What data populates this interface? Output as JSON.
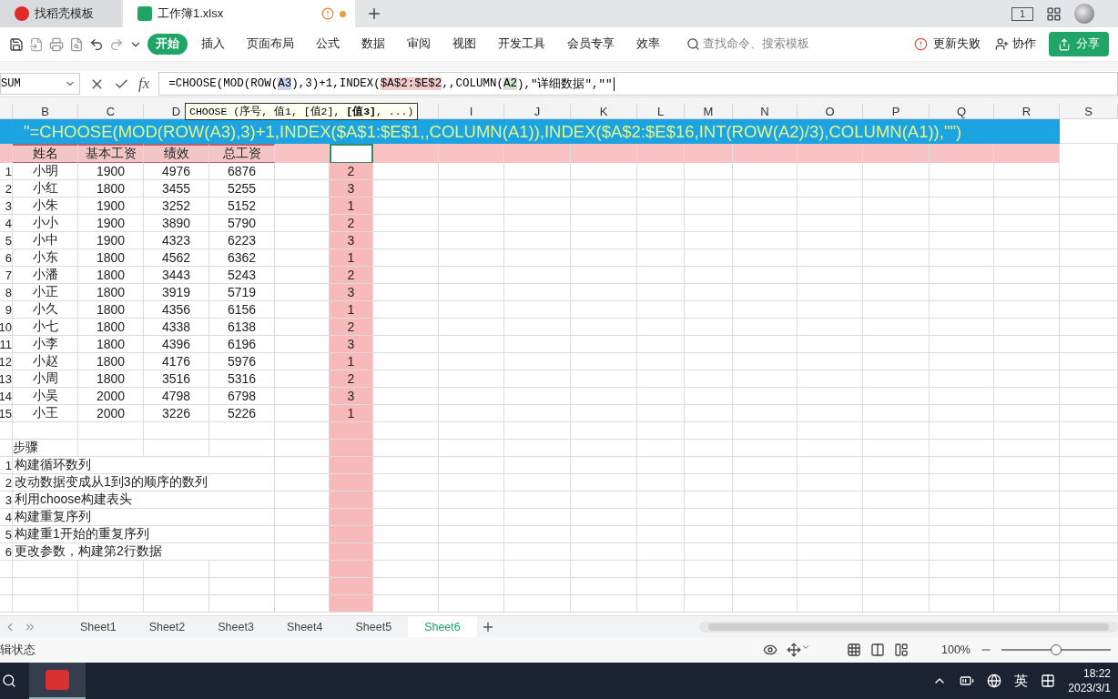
{
  "doc_tabs": [
    {
      "label": "找稻壳模板",
      "selected": false
    },
    {
      "label": "工作簿1.xlsx",
      "selected": true
    }
  ],
  "window_count": "1",
  "menu": [
    {
      "label": "开始",
      "selected": true
    },
    {
      "label": "插入",
      "selected": false
    },
    {
      "label": "页面布局",
      "selected": false
    },
    {
      "label": "公式",
      "selected": false
    },
    {
      "label": "数据",
      "selected": false
    },
    {
      "label": "审阅",
      "selected": false
    },
    {
      "label": "视图",
      "selected": false
    },
    {
      "label": "开发工具",
      "selected": false
    },
    {
      "label": "会员专享",
      "selected": false
    },
    {
      "label": "效率",
      "selected": false
    }
  ],
  "search": {
    "placeholder": "查找命令、搜索模板"
  },
  "update_status": "更新失败",
  "collaborate": "协作",
  "share": "分享",
  "name_box": "SUM",
  "fx_label": "fx",
  "formula": [
    {
      "text": "=CHOOSE(MOD(ROW("
    },
    {
      "text": "A3",
      "color": "#c9d4ee"
    },
    {
      "text": "),3)+1,INDEX("
    },
    {
      "text": "$A$2:$E$2",
      "color": "#f2caca"
    },
    {
      "text": ",,COLUMN("
    },
    {
      "text": "A2",
      "color": "#cfe4cf"
    },
    {
      "text": "),\"详细数据\",\"\""
    }
  ],
  "tooltip": "CHOOSE (序号, 值1, [值2], **[值3]**, ...)",
  "column_headers": [
    "B",
    "C",
    "D",
    "I",
    "J",
    "K",
    "L",
    "M",
    "N",
    "O",
    "P",
    "Q",
    "R",
    "S"
  ],
  "edit_overlay": "\"=CHOOSE(MOD(ROW(A3),3)+1,INDEX($A$1:$E$1,,COLUMN(A1)),INDEX($A$2:$E$16,INT(ROW(A2)/3),COLUMN(A1)),\"\")",
  "table_header": [
    "姓名",
    "基本工资",
    "绩效",
    "总工资"
  ],
  "rows": [
    {
      "no": "1",
      "cells": [
        "小明",
        "1900",
        "4976",
        "6876"
      ],
      "seq": "2"
    },
    {
      "no": "2",
      "cells": [
        "小红",
        "1800",
        "3455",
        "5255"
      ],
      "seq": "3"
    },
    {
      "no": "3",
      "cells": [
        "小朱",
        "1900",
        "3252",
        "5152"
      ],
      "seq": "1"
    },
    {
      "no": "4",
      "cells": [
        "小小",
        "1900",
        "3890",
        "5790"
      ],
      "seq": "2"
    },
    {
      "no": "5",
      "cells": [
        "小中",
        "1900",
        "4323",
        "6223"
      ],
      "seq": "3"
    },
    {
      "no": "6",
      "cells": [
        "小东",
        "1800",
        "4562",
        "6362"
      ],
      "seq": "1"
    },
    {
      "no": "7",
      "cells": [
        "小潘",
        "1800",
        "3443",
        "5243"
      ],
      "seq": "2"
    },
    {
      "no": "8",
      "cells": [
        "小正",
        "1800",
        "3919",
        "5719"
      ],
      "seq": "3"
    },
    {
      "no": "9",
      "cells": [
        "小久",
        "1800",
        "4356",
        "6156"
      ],
      "seq": "1"
    },
    {
      "no": "10",
      "cells": [
        "小七",
        "1800",
        "4338",
        "6138"
      ],
      "seq": "2"
    },
    {
      "no": "11",
      "cells": [
        "小李",
        "1800",
        "4396",
        "6196"
      ],
      "seq": "3"
    },
    {
      "no": "12",
      "cells": [
        "小赵",
        "1800",
        "4176",
        "5976"
      ],
      "seq": "1"
    },
    {
      "no": "13",
      "cells": [
        "小周",
        "1800",
        "3516",
        "5316"
      ],
      "seq": "2"
    },
    {
      "no": "14",
      "cells": [
        "小吴",
        "2000",
        "4798",
        "6798"
      ],
      "seq": "3"
    },
    {
      "no": "15",
      "cells": [
        "小王",
        "2000",
        "3226",
        "5226"
      ],
      "seq": "1"
    }
  ],
  "steps_title": "步骤",
  "steps": [
    {
      "no": "1",
      "text": "构建循环数列"
    },
    {
      "no": "2",
      "text": "改动数据变成从1到3的顺序的数列"
    },
    {
      "no": "3",
      "text": "利用choose构建表头"
    },
    {
      "no": "4",
      "text": "构建重复序列"
    },
    {
      "no": "5",
      "text": "构建重1开始的重复序列"
    },
    {
      "no": "6",
      "text": "更改参数，构建第2行数据"
    }
  ],
  "sheet_tabs": [
    {
      "label": "Sheet1",
      "selected": false
    },
    {
      "label": "Sheet2",
      "selected": false
    },
    {
      "label": "Sheet3",
      "selected": false
    },
    {
      "label": "Sheet4",
      "selected": false
    },
    {
      "label": "Sheet5",
      "selected": false
    },
    {
      "label": "Sheet6",
      "selected": true
    }
  ],
  "status_text": "辑状态",
  "zoom": {
    "label": "100%",
    "level": 0.5
  },
  "taskbar": {
    "ime": "英",
    "time": "18:22",
    "date": "2023/3/1"
  }
}
